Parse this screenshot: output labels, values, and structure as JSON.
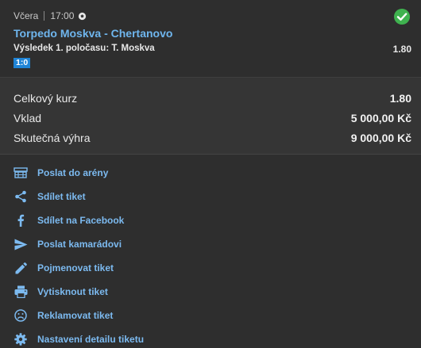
{
  "bet": {
    "day": "Včera",
    "time": "17:00",
    "sport_icon": "soccer-ball-icon",
    "status_icon": "check-circle-icon",
    "status_color": "#3fb24f",
    "match": "Torpedo Moskva - Chertanovo",
    "market": "Výsledek 1. poločasu: T. Moskva",
    "odd": "1.80",
    "score": "1:0"
  },
  "summary": {
    "total_odds_label": "Celkový kurz",
    "total_odds_value": "1.80",
    "stake_label": "Vklad",
    "stake_value": "5 000,00 Kč",
    "win_label": "Skutečná výhra",
    "win_value": "9 000,00 Kč"
  },
  "actions": [
    {
      "label": "Poslat do arény",
      "icon": "arena-icon"
    },
    {
      "label": "Sdílet tiket",
      "icon": "share-icon"
    },
    {
      "label": "Sdílet na Facebook",
      "icon": "facebook-icon"
    },
    {
      "label": "Poslat kamarádovi",
      "icon": "send-icon"
    },
    {
      "label": "Pojmenovat tiket",
      "icon": "pencil-icon"
    },
    {
      "label": "Vytisknout tiket",
      "icon": "printer-icon"
    },
    {
      "label": "Reklamovat tiket",
      "icon": "sad-face-icon"
    },
    {
      "label": "Nastavení detailu tiketu",
      "icon": "gear-icon"
    }
  ]
}
